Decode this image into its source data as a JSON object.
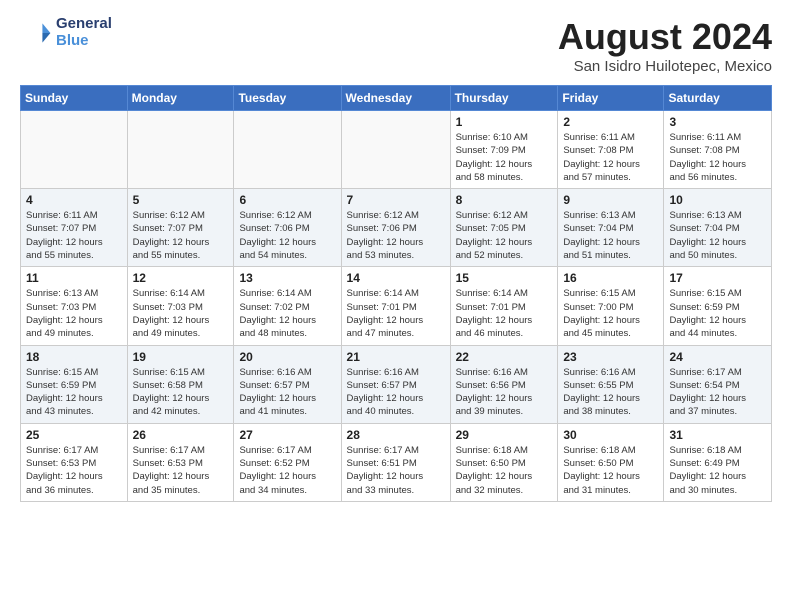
{
  "header": {
    "logo_line1": "General",
    "logo_line2": "Blue",
    "title": "August 2024",
    "subtitle": "San Isidro Huilotepec, Mexico"
  },
  "calendar": {
    "days_of_week": [
      "Sunday",
      "Monday",
      "Tuesday",
      "Wednesday",
      "Thursday",
      "Friday",
      "Saturday"
    ],
    "weeks": [
      [
        {
          "day": "",
          "info": ""
        },
        {
          "day": "",
          "info": ""
        },
        {
          "day": "",
          "info": ""
        },
        {
          "day": "",
          "info": ""
        },
        {
          "day": "1",
          "info": "Sunrise: 6:10 AM\nSunset: 7:09 PM\nDaylight: 12 hours\nand 58 minutes."
        },
        {
          "day": "2",
          "info": "Sunrise: 6:11 AM\nSunset: 7:08 PM\nDaylight: 12 hours\nand 57 minutes."
        },
        {
          "day": "3",
          "info": "Sunrise: 6:11 AM\nSunset: 7:08 PM\nDaylight: 12 hours\nand 56 minutes."
        }
      ],
      [
        {
          "day": "4",
          "info": "Sunrise: 6:11 AM\nSunset: 7:07 PM\nDaylight: 12 hours\nand 55 minutes."
        },
        {
          "day": "5",
          "info": "Sunrise: 6:12 AM\nSunset: 7:07 PM\nDaylight: 12 hours\nand 55 minutes."
        },
        {
          "day": "6",
          "info": "Sunrise: 6:12 AM\nSunset: 7:06 PM\nDaylight: 12 hours\nand 54 minutes."
        },
        {
          "day": "7",
          "info": "Sunrise: 6:12 AM\nSunset: 7:06 PM\nDaylight: 12 hours\nand 53 minutes."
        },
        {
          "day": "8",
          "info": "Sunrise: 6:12 AM\nSunset: 7:05 PM\nDaylight: 12 hours\nand 52 minutes."
        },
        {
          "day": "9",
          "info": "Sunrise: 6:13 AM\nSunset: 7:04 PM\nDaylight: 12 hours\nand 51 minutes."
        },
        {
          "day": "10",
          "info": "Sunrise: 6:13 AM\nSunset: 7:04 PM\nDaylight: 12 hours\nand 50 minutes."
        }
      ],
      [
        {
          "day": "11",
          "info": "Sunrise: 6:13 AM\nSunset: 7:03 PM\nDaylight: 12 hours\nand 49 minutes."
        },
        {
          "day": "12",
          "info": "Sunrise: 6:14 AM\nSunset: 7:03 PM\nDaylight: 12 hours\nand 49 minutes."
        },
        {
          "day": "13",
          "info": "Sunrise: 6:14 AM\nSunset: 7:02 PM\nDaylight: 12 hours\nand 48 minutes."
        },
        {
          "day": "14",
          "info": "Sunrise: 6:14 AM\nSunset: 7:01 PM\nDaylight: 12 hours\nand 47 minutes."
        },
        {
          "day": "15",
          "info": "Sunrise: 6:14 AM\nSunset: 7:01 PM\nDaylight: 12 hours\nand 46 minutes."
        },
        {
          "day": "16",
          "info": "Sunrise: 6:15 AM\nSunset: 7:00 PM\nDaylight: 12 hours\nand 45 minutes."
        },
        {
          "day": "17",
          "info": "Sunrise: 6:15 AM\nSunset: 6:59 PM\nDaylight: 12 hours\nand 44 minutes."
        }
      ],
      [
        {
          "day": "18",
          "info": "Sunrise: 6:15 AM\nSunset: 6:59 PM\nDaylight: 12 hours\nand 43 minutes."
        },
        {
          "day": "19",
          "info": "Sunrise: 6:15 AM\nSunset: 6:58 PM\nDaylight: 12 hours\nand 42 minutes."
        },
        {
          "day": "20",
          "info": "Sunrise: 6:16 AM\nSunset: 6:57 PM\nDaylight: 12 hours\nand 41 minutes."
        },
        {
          "day": "21",
          "info": "Sunrise: 6:16 AM\nSunset: 6:57 PM\nDaylight: 12 hours\nand 40 minutes."
        },
        {
          "day": "22",
          "info": "Sunrise: 6:16 AM\nSunset: 6:56 PM\nDaylight: 12 hours\nand 39 minutes."
        },
        {
          "day": "23",
          "info": "Sunrise: 6:16 AM\nSunset: 6:55 PM\nDaylight: 12 hours\nand 38 minutes."
        },
        {
          "day": "24",
          "info": "Sunrise: 6:17 AM\nSunset: 6:54 PM\nDaylight: 12 hours\nand 37 minutes."
        }
      ],
      [
        {
          "day": "25",
          "info": "Sunrise: 6:17 AM\nSunset: 6:53 PM\nDaylight: 12 hours\nand 36 minutes."
        },
        {
          "day": "26",
          "info": "Sunrise: 6:17 AM\nSunset: 6:53 PM\nDaylight: 12 hours\nand 35 minutes."
        },
        {
          "day": "27",
          "info": "Sunrise: 6:17 AM\nSunset: 6:52 PM\nDaylight: 12 hours\nand 34 minutes."
        },
        {
          "day": "28",
          "info": "Sunrise: 6:17 AM\nSunset: 6:51 PM\nDaylight: 12 hours\nand 33 minutes."
        },
        {
          "day": "29",
          "info": "Sunrise: 6:18 AM\nSunset: 6:50 PM\nDaylight: 12 hours\nand 32 minutes."
        },
        {
          "day": "30",
          "info": "Sunrise: 6:18 AM\nSunset: 6:50 PM\nDaylight: 12 hours\nand 31 minutes."
        },
        {
          "day": "31",
          "info": "Sunrise: 6:18 AM\nSunset: 6:49 PM\nDaylight: 12 hours\nand 30 minutes."
        }
      ]
    ]
  }
}
